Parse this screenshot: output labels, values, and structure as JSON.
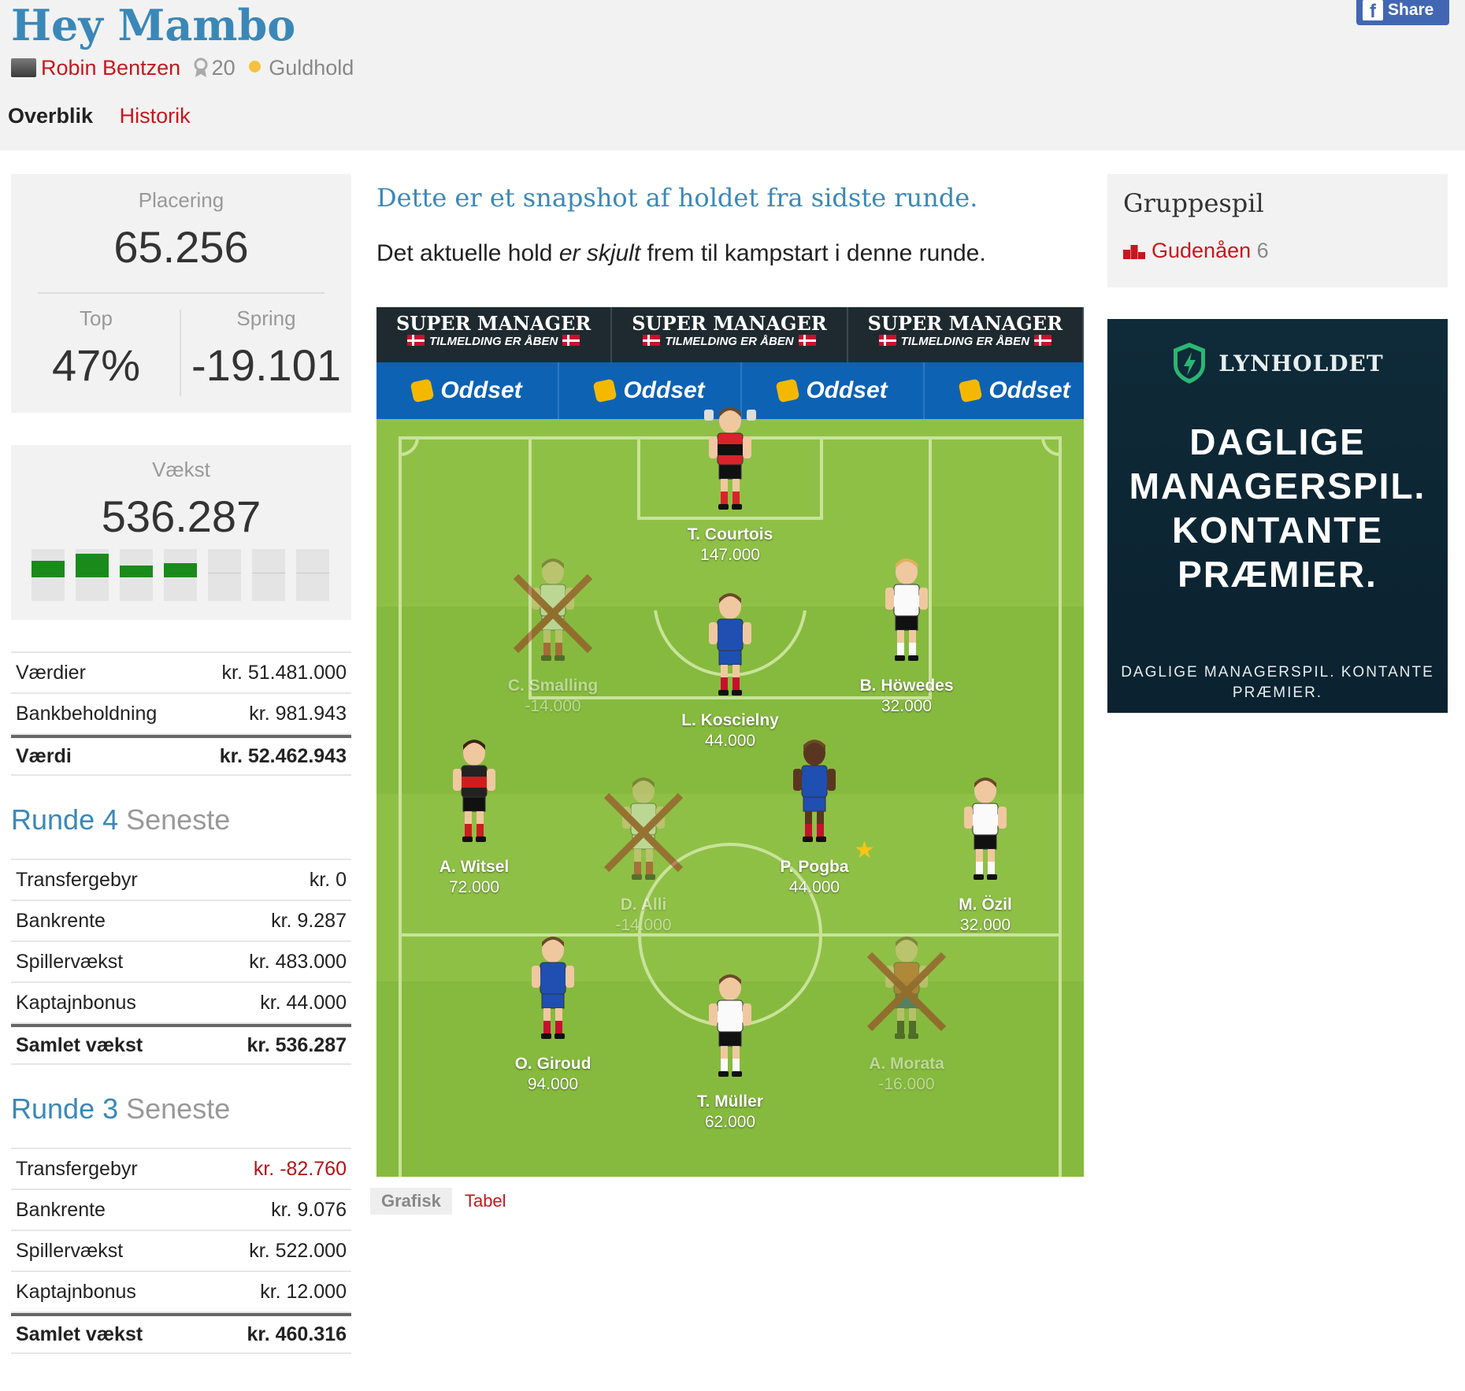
{
  "header": {
    "team_name": "Hey Mambo",
    "share_label": "Share",
    "owner": "Robin Bentzen",
    "level": "20",
    "tier": "Guldhold",
    "tabs": [
      {
        "label": "Overblik",
        "active": true
      },
      {
        "label": "Historik",
        "active": false
      }
    ]
  },
  "stats": {
    "placering_label": "Placering",
    "placering_value": "65.256",
    "top_label": "Top",
    "top_value": "47%",
    "spring_label": "Spring",
    "spring_value": "-19.101",
    "vaekst_label": "Vækst",
    "vaekst_value": "536.287",
    "growth_bars": [
      0.35,
      0.5,
      0.25,
      0.3,
      0,
      0,
      0
    ]
  },
  "summary": {
    "rows": [
      {
        "label": "Værdier",
        "value": "kr. 51.481.000"
      },
      {
        "label": "Bankbeholdning",
        "value": "kr. 981.943"
      }
    ],
    "total": {
      "label": "Værdi",
      "value": "kr. 52.462.943"
    }
  },
  "rounds": [
    {
      "title": "Runde 4",
      "suffix": "Seneste",
      "rows": [
        {
          "label": "Transfergebyr",
          "value": "kr. 0",
          "negative": false
        },
        {
          "label": "Bankrente",
          "value": "kr. 9.287",
          "negative": false
        },
        {
          "label": "Spillervækst",
          "value": "kr. 483.000",
          "negative": false
        },
        {
          "label": "Kaptajnbonus",
          "value": "kr. 44.000",
          "negative": false
        }
      ],
      "total": {
        "label": "Samlet vækst",
        "value": "kr. 536.287"
      }
    },
    {
      "title": "Runde 3",
      "suffix": "Seneste",
      "rows": [
        {
          "label": "Transfergebyr",
          "value": "kr. -82.760",
          "negative": true
        },
        {
          "label": "Bankrente",
          "value": "kr. 9.076",
          "negative": false
        },
        {
          "label": "Spillervækst",
          "value": "kr. 522.000",
          "negative": false
        },
        {
          "label": "Kaptajnbonus",
          "value": "kr. 12.000",
          "negative": false
        }
      ],
      "total": {
        "label": "Samlet vækst",
        "value": "kr. 460.316"
      }
    }
  ],
  "snapshot": {
    "title": "Dette er et snapshot af holdet fra sidste runde.",
    "sub_before": "Det aktuelle hold ",
    "sub_em": "er skjult",
    "sub_after": " frem til kampstart i denne runde."
  },
  "banners": {
    "super_manager": "SUPER MANAGER",
    "tilmelding": "TILMELDING ER ÅBEN",
    "oddset": "Oddset"
  },
  "players": [
    {
      "name": "T. Courtois",
      "points": "147.000",
      "kit": "belgium",
      "out": false,
      "captain": false,
      "keeper": true
    },
    {
      "name": "C. Smalling",
      "points": "-14.000",
      "kit": "england",
      "out": true,
      "captain": false,
      "keeper": false
    },
    {
      "name": "L. Koscielny",
      "points": "44.000",
      "kit": "france",
      "out": false,
      "captain": false,
      "keeper": false
    },
    {
      "name": "B. Höwedes",
      "points": "32.000",
      "kit": "germany",
      "out": false,
      "captain": false,
      "keeper": false
    },
    {
      "name": "A. Witsel",
      "points": "72.000",
      "kit": "belgium",
      "out": false,
      "captain": false,
      "keeper": false
    },
    {
      "name": "D. Alli",
      "points": "-14.000",
      "kit": "england",
      "out": true,
      "captain": false,
      "keeper": false
    },
    {
      "name": "P. Pogba",
      "points": "44.000",
      "kit": "france",
      "out": false,
      "captain": true,
      "keeper": false
    },
    {
      "name": "M. Özil",
      "points": "32.000",
      "kit": "germany",
      "out": false,
      "captain": false,
      "keeper": false
    },
    {
      "name": "O. Giroud",
      "points": "94.000",
      "kit": "france",
      "out": false,
      "captain": false,
      "keeper": false
    },
    {
      "name": "T. Müller",
      "points": "62.000",
      "kit": "germany",
      "out": false,
      "captain": false,
      "keeper": false
    },
    {
      "name": "A. Morata",
      "points": "-16.000",
      "kit": "spain",
      "out": true,
      "captain": false,
      "keeper": false
    }
  ],
  "view_toggle": {
    "grafisk": "Grafisk",
    "tabel": "Tabel"
  },
  "group": {
    "title": "Gruppespil",
    "item_label": "Gudenåen",
    "item_count": "6"
  },
  "ad": {
    "brand": "LYNHOLDET",
    "headline": "DAGLIGE MANAGERSPIL. KONTANTE PRÆMIER.",
    "small": "DAGLIGE MANAGERSPIL. KONTANTE PRÆMIER."
  },
  "colors": {
    "accent_blue": "#3a88b8",
    "link_red": "#c8161d",
    "growth_green": "#1a8a1a",
    "pitch_green": "#86ba3e",
    "negative_red": "#b21217"
  }
}
